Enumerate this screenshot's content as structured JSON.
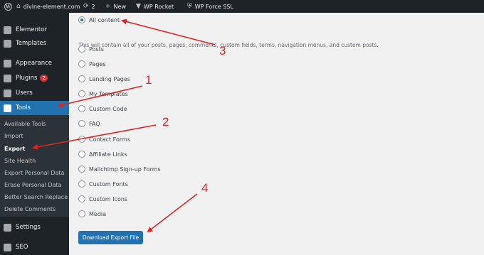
{
  "admin_bar": {
    "site_name": "divine-element.com",
    "updates_count": "2",
    "new_label": "New",
    "plugins": [
      "WP Rocket",
      "WP Force SSL"
    ]
  },
  "sidebar": {
    "items": [
      {
        "label": "Elementor",
        "icon": "elementor-icon"
      },
      {
        "label": "Templates",
        "icon": "templates-icon"
      },
      {
        "label": "Appearance",
        "icon": "appearance-icon"
      },
      {
        "label": "Plugins",
        "icon": "plugins-icon",
        "badge": "2"
      },
      {
        "label": "Users",
        "icon": "users-icon"
      },
      {
        "label": "Tools",
        "icon": "wrench-icon",
        "current": true
      },
      {
        "label": "Settings",
        "icon": "settings-icon"
      },
      {
        "label": "SEO",
        "icon": "seo-icon"
      }
    ],
    "tools_submenu": [
      {
        "label": "Available Tools"
      },
      {
        "label": "Import"
      },
      {
        "label": "Export",
        "current": true
      },
      {
        "label": "Site Health"
      },
      {
        "label": "Export Personal Data"
      },
      {
        "label": "Erase Personal Data"
      },
      {
        "label": "Better Search Replace"
      },
      {
        "label": "Delete Comments"
      }
    ]
  },
  "export": {
    "all_content_label": "All content",
    "all_content_description": "This will contain all of your posts, pages, comments, custom fields, terms, navigation menus, and custom posts.",
    "options": [
      "Posts",
      "Pages",
      "Landing Pages",
      "My Templates",
      "Custom Code",
      "FAQ",
      "Contact Forms",
      "Affiliate Links",
      "Mailchimp Sign-up Forms",
      "Custom Fonts",
      "Custom Icons",
      "Media"
    ],
    "selected": "All content",
    "download_button": "Download Export File"
  },
  "annotations": [
    "1",
    "2",
    "3",
    "4"
  ],
  "colors": {
    "admin_bar": "#1d2327",
    "accent": "#2271b1",
    "annotation": "#e02424"
  }
}
